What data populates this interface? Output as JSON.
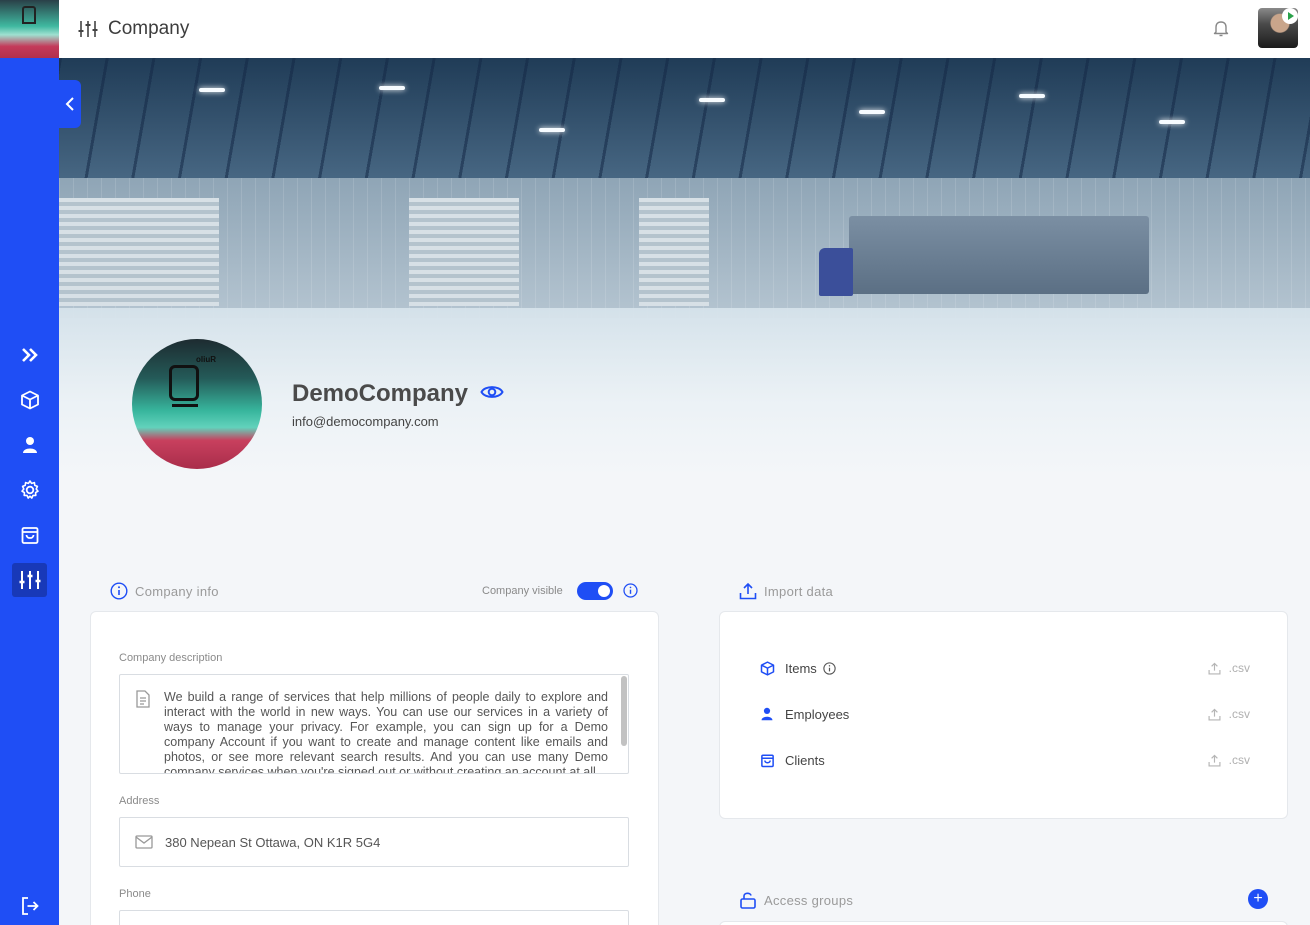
{
  "header": {
    "title": "Company"
  },
  "company": {
    "name": "DemoCompany",
    "email": "info@democompany.com",
    "logo_text": "oliuR"
  },
  "company_info": {
    "section_label": "Company info",
    "visible_label": "Company visible",
    "visible": true,
    "description_label": "Company description",
    "description": "We build a range of services that help millions of people daily to explore and interact with the world in new ways. You can use our services in a variety of ways to manage your privacy. For example, you can sign up for a Demo company Account if you want to create and manage content like emails and photos, or see more relevant search results. And you can use many Demo company services when you're signed out or without creating an account at all.",
    "address_label": "Address",
    "address": "380 Nepean St Ottawa, ON K1R 5G4",
    "phone_label": "Phone"
  },
  "import_data": {
    "section_label": "Import data",
    "rows": [
      {
        "label": "Items",
        "icon": "cube-icon",
        "has_info": true,
        "action": ".csv"
      },
      {
        "label": "Employees",
        "icon": "person-icon",
        "has_info": false,
        "action": ".csv"
      },
      {
        "label": "Clients",
        "icon": "bag-icon",
        "has_info": false,
        "action": ".csv"
      }
    ]
  },
  "access_groups": {
    "section_label": "Access groups",
    "add_symbol": "+"
  },
  "sidebar": {
    "items": [
      {
        "icon": "double-chevron-right-icon"
      },
      {
        "icon": "cube-icon"
      },
      {
        "icon": "person-icon"
      },
      {
        "icon": "gear-icon"
      },
      {
        "icon": "bag-icon"
      },
      {
        "icon": "sliders-icon",
        "active": true
      }
    ],
    "bottom": {
      "icon": "logout-icon"
    }
  },
  "colors": {
    "accent": "#1f4ef5",
    "accent_dark": "#1839b8",
    "page_bg": "#f4f6f9"
  }
}
